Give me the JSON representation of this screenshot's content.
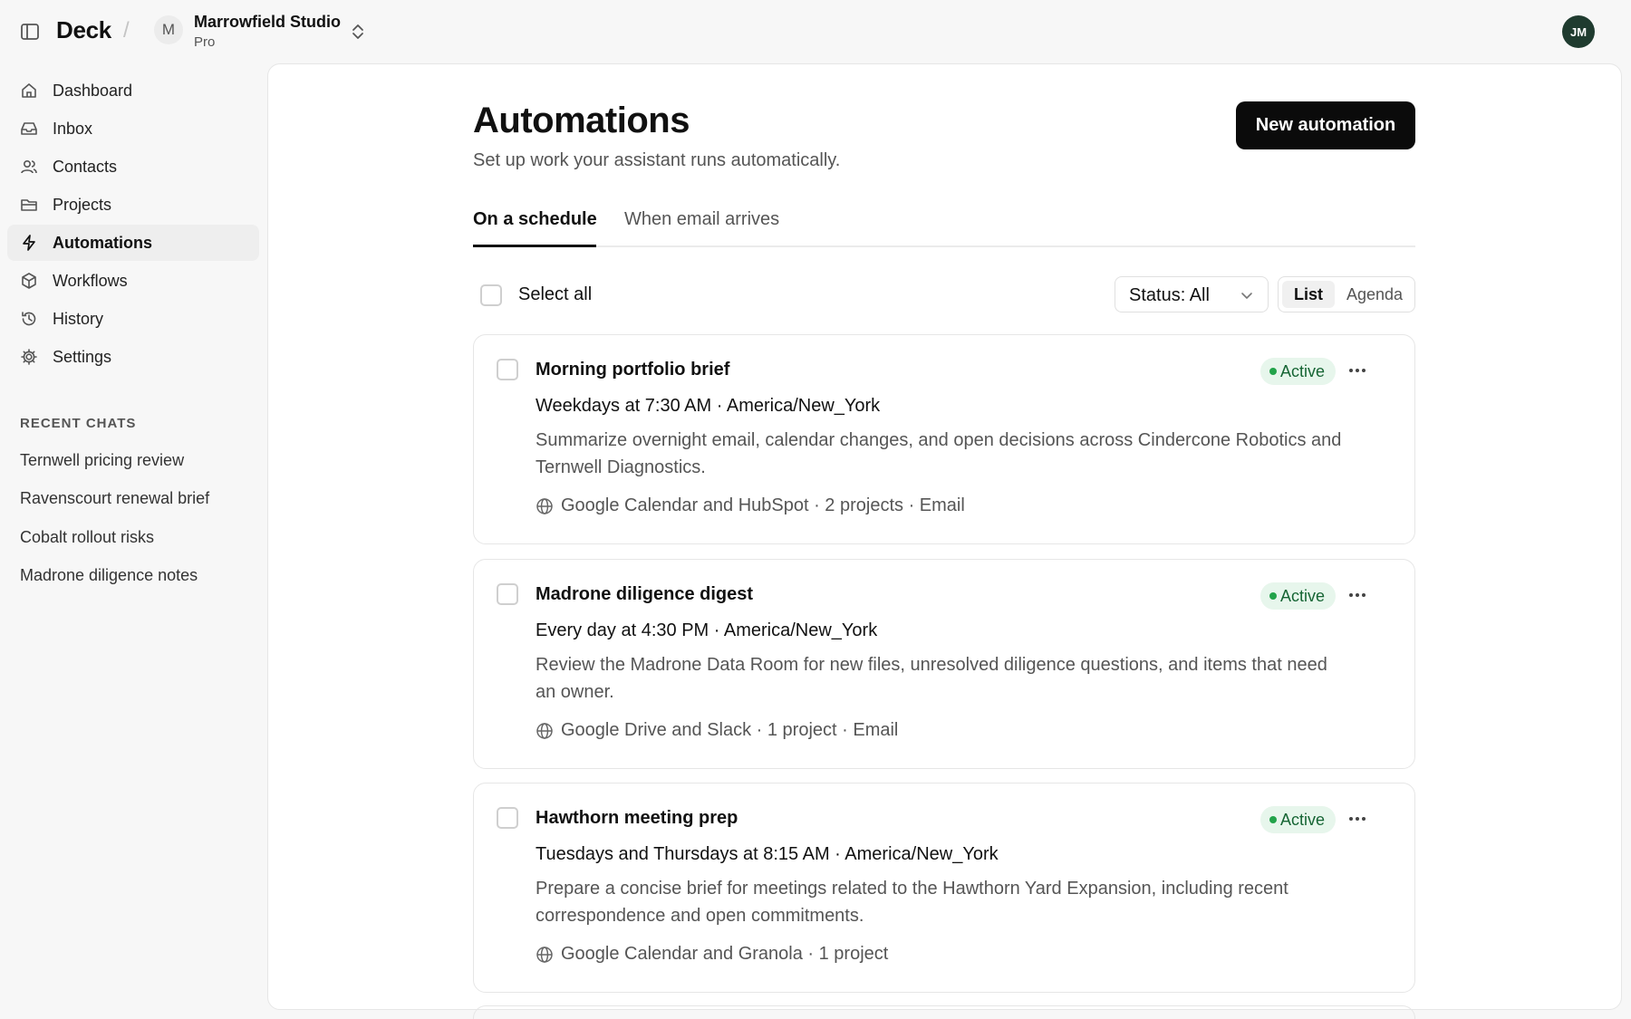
{
  "header": {
    "brand": "Deck",
    "separator": "/",
    "workspace": {
      "initial": "M",
      "name": "Marrowfield Studio",
      "plan": "Pro"
    },
    "user_initials": "JM"
  },
  "sidebar": {
    "items": [
      {
        "label": "Dashboard",
        "icon": "home-icon"
      },
      {
        "label": "Inbox",
        "icon": "inbox-icon"
      },
      {
        "label": "Contacts",
        "icon": "users-icon"
      },
      {
        "label": "Projects",
        "icon": "folder-icon"
      },
      {
        "label": "Automations",
        "icon": "bolt-icon",
        "active": true
      },
      {
        "label": "Workflows",
        "icon": "cube-icon"
      },
      {
        "label": "History",
        "icon": "history-icon"
      },
      {
        "label": "Settings",
        "icon": "gear-icon"
      }
    ],
    "recent_label": "RECENT CHATS",
    "recent_chats": [
      "Ternwell pricing review",
      "Ravenscourt renewal brief",
      "Cobalt rollout risks",
      "Madrone diligence notes"
    ]
  },
  "main": {
    "title": "Automations",
    "subtitle": "Set up work your assistant runs automatically.",
    "new_button": "New automation",
    "tabs": [
      {
        "label": "On a schedule",
        "active": true
      },
      {
        "label": "When email arrives",
        "active": false
      }
    ],
    "select_all": "Select all",
    "status_filter": "Status: All",
    "view_options": [
      {
        "label": "List",
        "active": true
      },
      {
        "label": "Agenda",
        "active": false
      }
    ],
    "automations": [
      {
        "title": "Morning portfolio brief",
        "status": "Active",
        "schedule": "Weekdays at 7:30 AM · America/New_York",
        "description": "Summarize overnight email, calendar changes, and open decisions across Cindercone Robotics and Ternwell Diagnostics.",
        "meta": "Google Calendar and HubSpot · 2 projects · Email"
      },
      {
        "title": "Madrone diligence digest",
        "status": "Active",
        "schedule": "Every day at 4:30 PM · America/New_York",
        "description": "Review the Madrone Data Room for new files, unresolved diligence questions, and items that need an owner.",
        "meta": "Google Drive and Slack · 1 project · Email"
      },
      {
        "title": "Hawthorn meeting prep",
        "status": "Active",
        "schedule": "Tuesdays and Thursdays at 8:15 AM · America/New_York",
        "description": "Prepare a concise brief for meetings related to the Hawthorn Yard Expansion, including recent correspondence and open commitments.",
        "meta": "Google Calendar and Granola · 1 project"
      }
    ]
  },
  "colors": {
    "accent": "#0b0b0b",
    "active_badge_bg": "#e7f6ec",
    "active_badge_text": "#166534",
    "active_dot": "#22a34a",
    "user_avatar": "#1f3b2f"
  }
}
